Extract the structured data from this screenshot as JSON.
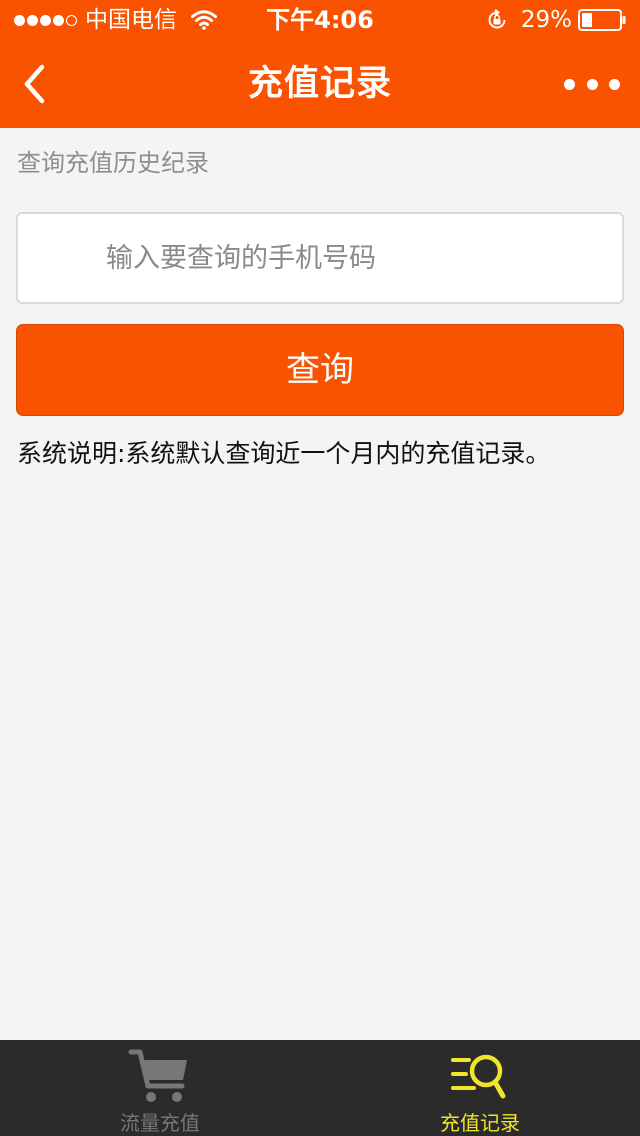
{
  "status_bar": {
    "carrier": "中国电信",
    "time": "下午4:06",
    "battery_percent": "29%",
    "battery_level": 0.29,
    "signal_bars_filled": 4,
    "signal_bars_total": 5
  },
  "header": {
    "title": "充值记录",
    "back_icon": "chevron-left-icon",
    "more_icon": "more-dots-icon",
    "background_color": "#f95200"
  },
  "query_form": {
    "section_label": "查询充值历史纪录",
    "phone_input": {
      "placeholder": "输入要查询的手机号码",
      "value": ""
    },
    "submit_label": "查询"
  },
  "note": "系统说明:系统默认查询近一个月内的充值记录。",
  "tab_bar": {
    "tabs": [
      {
        "label": "流量充值",
        "icon": "cart-icon",
        "active": false
      },
      {
        "label": "充值记录",
        "icon": "record-search-icon",
        "active": true
      }
    ],
    "active_color": "#f1e52a",
    "inactive_color": "#777777"
  }
}
